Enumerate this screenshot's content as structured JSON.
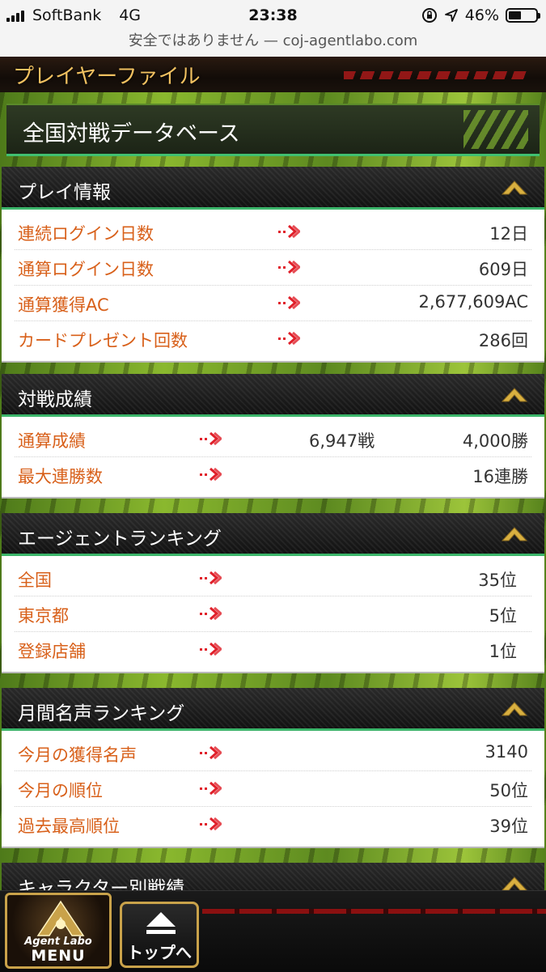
{
  "status_bar": {
    "carrier": "SoftBank",
    "network": "4G",
    "time": "23:38",
    "battery": "46%",
    "battery_level": 0.46,
    "url_text": "安全ではありません — coj-agentlabo.com"
  },
  "page": {
    "header_title": "プレイヤーファイル",
    "db_title": "全国対戦データベース"
  },
  "sections": {
    "play_info": {
      "title": "プレイ情報",
      "rows": [
        {
          "label": "連続ログイン日数",
          "value": "12日"
        },
        {
          "label": "通算ログイン日数",
          "value": "609日"
        },
        {
          "label": "通算獲得AC",
          "value": "2,677,609AC"
        },
        {
          "label": "カードプレゼント回数",
          "value": "286回"
        }
      ]
    },
    "battle_record": {
      "title": "対戦成績",
      "rows": [
        {
          "label": "通算成績",
          "value1": "6,947戦",
          "value2": "4,000勝"
        },
        {
          "label": "最大連勝数",
          "value2": "16連勝"
        }
      ]
    },
    "agent_ranking": {
      "title": "エージェントランキング",
      "rows": [
        {
          "label": "全国",
          "value": "35位"
        },
        {
          "label": "東京都",
          "value": "5位"
        },
        {
          "label": "登録店舗",
          "value": "1位"
        }
      ]
    },
    "fame_ranking": {
      "title": "月間名声ランキング",
      "rows": [
        {
          "label": "今月の獲得名声",
          "value": "3140"
        },
        {
          "label": "今月の順位",
          "value": "50位"
        },
        {
          "label": "過去最高順位",
          "value": "39位"
        }
      ]
    },
    "character_record": {
      "title": "キャラクター別戦績"
    }
  },
  "footer": {
    "menu_line1": "Agent Labo",
    "menu_line2": "MENU",
    "top_label": "トップへ"
  },
  "icons": {
    "arrow": "double-arrow-icon",
    "collapse": "chevron-up-icon"
  },
  "colors": {
    "label": "#d8601a",
    "accent_green": "#3bb56a",
    "arrow_red": "#e0202a",
    "chevron_gold": "#d9b040"
  }
}
